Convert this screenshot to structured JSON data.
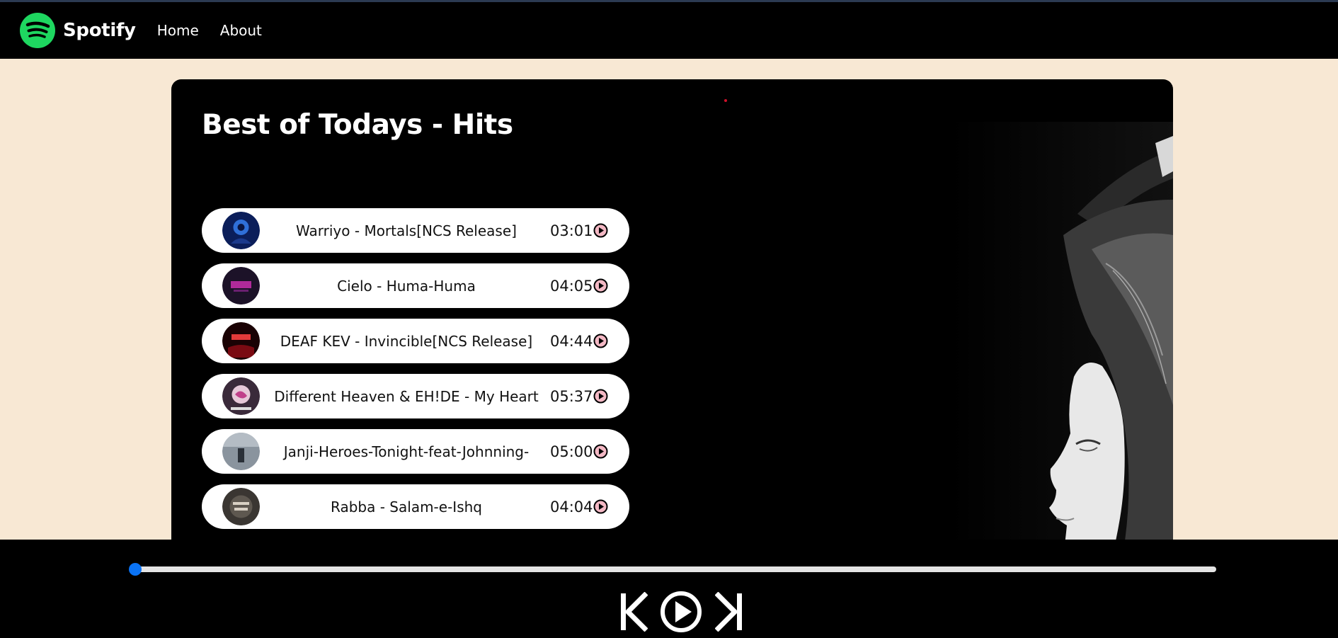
{
  "nav": {
    "brand": "Spotify",
    "links": [
      "Home",
      "About"
    ]
  },
  "playlist": {
    "title": "Best of Todays - Hits",
    "songs": [
      {
        "name": "Warriyo - Mortals[NCS Release]",
        "time": "03:01",
        "cover_color": "#1b3a8c"
      },
      {
        "name": "Cielo - Huma-Huma",
        "time": "04:05",
        "cover_color": "#3a1c4a"
      },
      {
        "name": "DEAF KEV - Invincible[NCS Release]",
        "time": "04:44",
        "cover_color": "#5a0a0e"
      },
      {
        "name": "Different Heaven & EH!DE - My Heart",
        "time": "05:37",
        "cover_color": "#8a4a70"
      },
      {
        "name": "Janji-Heroes-Tonight-feat-Johnning-",
        "time": "05:00",
        "cover_color": "#5a6470"
      },
      {
        "name": "Rabba - Salam-e-Ishq",
        "time": "04:04",
        "cover_color": "#4a4540"
      }
    ]
  },
  "player": {
    "progress": 0,
    "accent": "#0a73f5"
  },
  "colors": {
    "spotify_green": "#1ed760",
    "page_bg": "#f8e8d4"
  }
}
